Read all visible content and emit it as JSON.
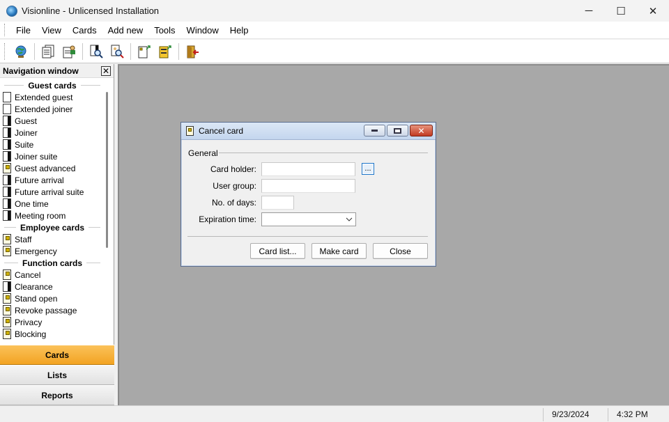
{
  "window": {
    "title": "Visionline - Unlicensed Installation",
    "minimize_glyph": "─",
    "maximize_glyph": "☐",
    "close_glyph": "✕"
  },
  "menu": {
    "items": [
      "File",
      "View",
      "Cards",
      "Add new",
      "Tools",
      "Window",
      "Help"
    ]
  },
  "toolbar": {
    "icons": [
      "globe-icon",
      "card-list-icon",
      "user-card-icon",
      "search-card-icon",
      "search-user-icon",
      "new-card-icon",
      "encode-card-icon",
      "exit-door-icon"
    ]
  },
  "navigation": {
    "title": "Navigation window",
    "close_glyph": "✕",
    "sections": [
      {
        "title": "Guest cards",
        "items": [
          {
            "label": "Extended guest",
            "icon": "card-plain"
          },
          {
            "label": "Extended joiner",
            "icon": "card-plain"
          },
          {
            "label": "Guest",
            "icon": "card-half"
          },
          {
            "label": "Joiner",
            "icon": "card-half"
          },
          {
            "label": "Suite",
            "icon": "card-half"
          },
          {
            "label": "Joiner suite",
            "icon": "card-half"
          },
          {
            "label": "Guest advanced",
            "icon": "card-chip"
          },
          {
            "label": "Future arrival",
            "icon": "card-half"
          },
          {
            "label": "Future arrival suite",
            "icon": "card-half"
          },
          {
            "label": "One time",
            "icon": "card-half"
          },
          {
            "label": "Meeting room",
            "icon": "card-half"
          }
        ]
      },
      {
        "title": "Employee cards",
        "items": [
          {
            "label": "Staff",
            "icon": "card-chip"
          },
          {
            "label": "Emergency",
            "icon": "card-chip"
          }
        ]
      },
      {
        "title": "Function cards",
        "items": [
          {
            "label": "Cancel",
            "icon": "card-chip"
          },
          {
            "label": "Clearance",
            "icon": "card-half"
          },
          {
            "label": "Stand open",
            "icon": "card-chip"
          },
          {
            "label": "Revoke passage",
            "icon": "card-chip"
          },
          {
            "label": "Privacy",
            "icon": "card-chip"
          },
          {
            "label": "Blocking",
            "icon": "card-chip"
          }
        ]
      }
    ],
    "tabs": [
      {
        "label": "Cards",
        "active": true
      },
      {
        "label": "Lists",
        "active": false
      },
      {
        "label": "Reports",
        "active": false
      }
    ]
  },
  "dialog": {
    "title": "Cancel card",
    "close_glyph": "✕",
    "group_label": "General",
    "fields": {
      "card_holder": {
        "label": "Card holder:",
        "value": ""
      },
      "user_group": {
        "label": "User group:",
        "value": ""
      },
      "no_of_days": {
        "label": "No. of days:",
        "value": ""
      },
      "expiration_time": {
        "label": "Expiration time:",
        "value": ""
      }
    },
    "browse_label": "...",
    "buttons": {
      "card_list": "Card list...",
      "make_card": "Make card",
      "close": "Close"
    }
  },
  "status": {
    "date": "9/23/2024",
    "time": "4:32 PM"
  },
  "colors": {
    "active_tab": "#f2a322",
    "workspace": "#a8a8a8",
    "dialog_title": "#c4d6ee",
    "dialog_close": "#c13a22"
  }
}
